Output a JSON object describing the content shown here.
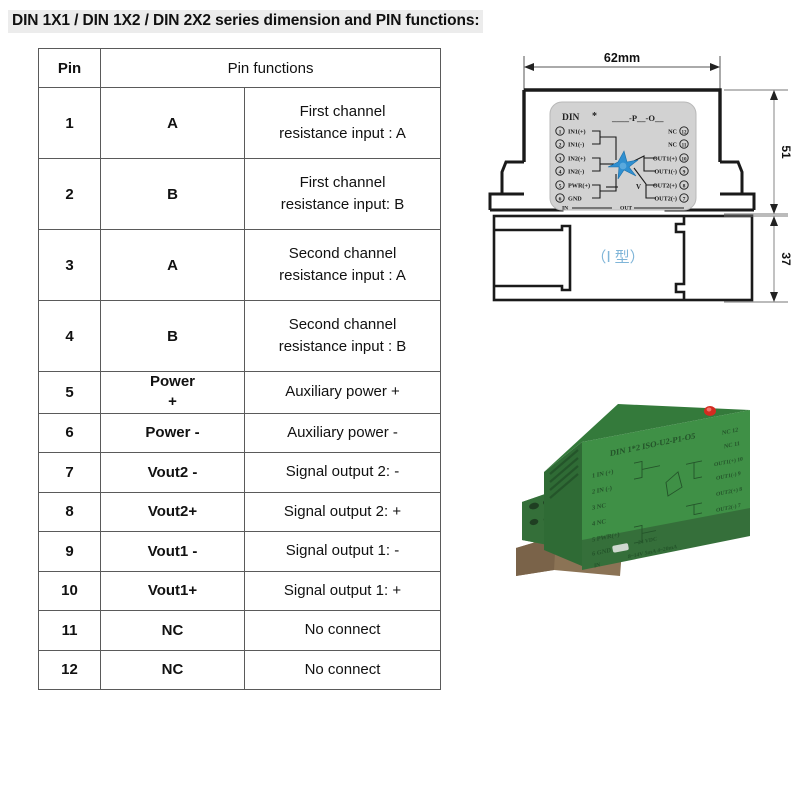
{
  "document": {
    "title": "DIN 1X1 / DIN 1X2 / DIN 2X2 series dimension and PIN functions:"
  },
  "table": {
    "headers": {
      "pin": "Pin",
      "functions": "Pin functions"
    },
    "rows": [
      {
        "pin": "1",
        "symbol": "A",
        "symbol2": "",
        "fn_line1": "First channel",
        "fn_line2": "resistance input : A"
      },
      {
        "pin": "2",
        "symbol": "B",
        "symbol2": "",
        "fn_line1": "First channel",
        "fn_line2": "resistance input: B"
      },
      {
        "pin": "3",
        "symbol": "A",
        "symbol2": "",
        "fn_line1": "Second channel",
        "fn_line2": "resistance input : A"
      },
      {
        "pin": "4",
        "symbol": "B",
        "symbol2": "",
        "fn_line1": "Second channel",
        "fn_line2": "resistance input : B"
      },
      {
        "pin": "5",
        "symbol": "Power",
        "symbol2": "+",
        "fn_line1": "Auxiliary power +",
        "fn_line2": ""
      },
      {
        "pin": "6",
        "symbol": "Power -",
        "symbol2": "",
        "fn_line1": "Auxiliary power -",
        "fn_line2": ""
      },
      {
        "pin": "7",
        "symbol": "Vout2 -",
        "symbol2": "",
        "fn_line1": "Signal output  2: -",
        "fn_line2": ""
      },
      {
        "pin": "8",
        "symbol": "Vout2+",
        "symbol2": "",
        "fn_line1": "Signal output 2: +",
        "fn_line2": ""
      },
      {
        "pin": "9",
        "symbol": "Vout1 -",
        "symbol2": "",
        "fn_line1": "Signal output 1: -",
        "fn_line2": ""
      },
      {
        "pin": "10",
        "symbol": "Vout1+",
        "symbol2": "",
        "fn_line1": "Signal output 1: +",
        "fn_line2": ""
      },
      {
        "pin": "11",
        "symbol": "NC",
        "symbol2": "",
        "fn_line1": "No connect",
        "fn_line2": ""
      },
      {
        "pin": "12",
        "symbol": "NC",
        "symbol2": "",
        "fn_line1": "No connect",
        "fn_line2": ""
      }
    ]
  },
  "drawing": {
    "dim_width": "62mm",
    "dim_height_upper": "51",
    "dim_height_lower": "37",
    "type_label": "（Ⅰ 型）",
    "label_plate": {
      "model_prefix": "DIN",
      "model_star": "*",
      "model_suffix": "-P__-O__",
      "left_pins": [
        {
          "num": "1",
          "name": "IN1(+)"
        },
        {
          "num": "2",
          "name": "IN1(-)"
        },
        {
          "num": "3",
          "name": "IN2(+)"
        },
        {
          "num": "4",
          "name": "IN2(-)"
        },
        {
          "num": "5",
          "name": "PWR(+)"
        },
        {
          "num": "6",
          "name": "GND"
        }
      ],
      "right_pins": [
        {
          "num": "12",
          "name": "NC"
        },
        {
          "num": "11",
          "name": "NC"
        },
        {
          "num": "10",
          "name": "OUT1(+)"
        },
        {
          "num": "9",
          "name": "OUT1(-)"
        },
        {
          "num": "8",
          "name": "OUT2(+)"
        },
        {
          "num": "7",
          "name": "OUT2(-)"
        }
      ],
      "voltage_mark": "V",
      "footer_in": "IN",
      "footer_out": "OUT"
    },
    "colors": {
      "plate_fill": "#d2d2d2",
      "star_blue": "#2f8fd0",
      "type_text": "#7fb5d8",
      "outline": "#1a1a1a"
    }
  },
  "photo": {
    "model_text": "DIN 1*2 ISO-U2-P1-O5",
    "label_lines": [
      "1 IN (+)",
      "2 IN (-)",
      "3 NC",
      "4 NC",
      "5 PWR(+)",
      "6 GND"
    ],
    "label_right_lines": [
      "NC 12",
      "NC 11",
      "OUT1(+) 10",
      "OUT1(-) 9",
      "OUT2(+) 8",
      "OUT2(-) 7"
    ],
    "footer_text": "8~14V  5mA  4~20mA",
    "colors": {
      "case_front": "#3f9046",
      "case_top": "#347a3b",
      "case_side": "#2f6b35",
      "case_dark": "#2a5e30",
      "terminal": "#3c8a42",
      "led": "#d42b20",
      "rail": "#8b7355"
    }
  }
}
